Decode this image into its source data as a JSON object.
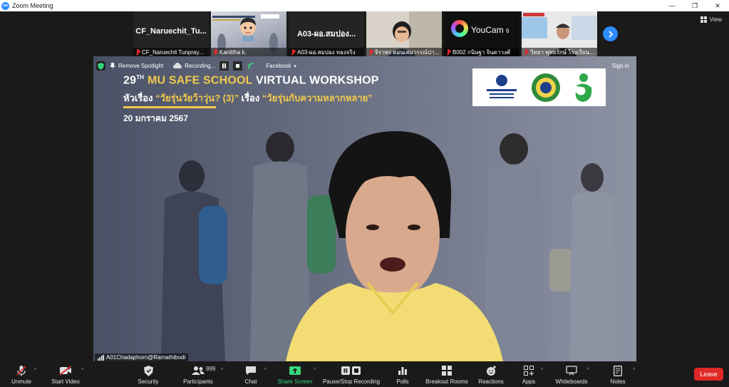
{
  "window": {
    "title": "Zoom Meeting",
    "logo_text": "zm"
  },
  "strip": {
    "tiles": [
      {
        "big": "CF_Naruechit_Tu...",
        "name": "CF_Naruechit Tunpray..."
      },
      {
        "big": "",
        "name": "Kanittha k."
      },
      {
        "big": "A03-ผอ.สมปอง...",
        "name": "A03-ผอ.สมปอง ทองจริง"
      },
      {
        "big": "",
        "name": "จิราพร ดอนเสมารรณ์ปา..."
      },
      {
        "big": "",
        "name": "B002 กนิษฐา จินดาวงศ์"
      },
      {
        "big": "",
        "name": "วิทยา พุทธรักษ์ โรงเรียน..."
      }
    ],
    "youcam_text": "YouCam",
    "youcam_num": "6",
    "view_label": "View"
  },
  "main": {
    "remove_spotlight": "Remove Spotlight",
    "recording": "Recording...",
    "facebook": "Facebook",
    "signin": "Sign in",
    "title_num": "29",
    "title_sup": "TH",
    "title_mu": "MU SAFE SCHOOL",
    "title_rest": "VIRTUAL WORKSHOP",
    "sub_a": "หัวเรื่อง",
    "sub_b": "“วัยรุ่นวัยว้าวุ่น? (3)”",
    "sub_c": "เรื่อง",
    "sub_d": "“วัยรุ่นกับความหลากหลาย”",
    "date": "20 มกราคม 2567",
    "speaker": "A01Chadaphorn@Ramathibodi"
  },
  "toolbar": {
    "unmute": "Unmute",
    "start_video": "Start Video",
    "security": "Security",
    "participants": "Participants",
    "participants_count": "999",
    "chat": "Chat",
    "share_screen": "Share Screen",
    "pause_recording": "Pause/Stop Recording",
    "polls": "Polls",
    "breakout": "Breakout Rooms",
    "reactions": "Reactions",
    "apps": "Apps",
    "whiteboards": "Whiteboards",
    "notes": "Notes",
    "leave": "Leave"
  },
  "colors": {
    "accent": "#2d8cff",
    "leave": "#e02828",
    "share": "#37d67a",
    "slide_yellow": "#f2c94c"
  }
}
